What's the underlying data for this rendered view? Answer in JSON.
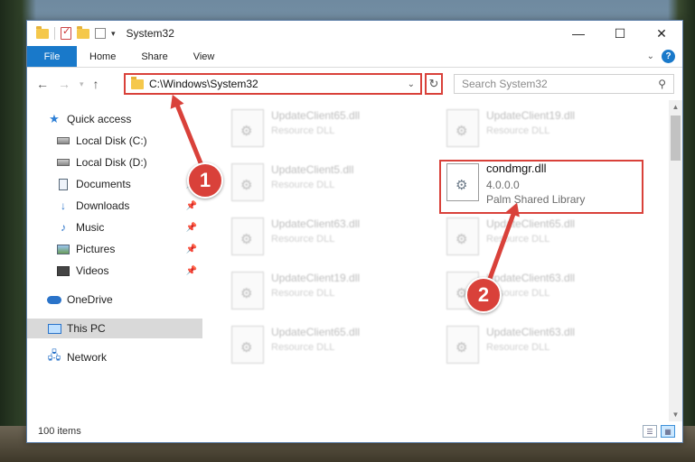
{
  "window": {
    "title": "System32",
    "controls": {
      "minimize": "—",
      "maximize": "☐",
      "close": "✕"
    }
  },
  "ribbon": {
    "tabs": [
      "File",
      "Home",
      "Share",
      "View"
    ],
    "help": "?"
  },
  "address": {
    "path": "C:\\Windows\\System32",
    "search_placeholder": "Search System32"
  },
  "sidebar": {
    "items": [
      {
        "label": "Quick access",
        "icon": "star-icon",
        "pinned": false
      },
      {
        "label": "Local Disk (C:)",
        "icon": "disk-icon",
        "pinned": false
      },
      {
        "label": "Local Disk (D:)",
        "icon": "disk-icon",
        "pinned": false
      },
      {
        "label": "Documents",
        "icon": "documents-icon",
        "pinned": true
      },
      {
        "label": "Downloads",
        "icon": "downloads-icon",
        "pinned": true
      },
      {
        "label": "Music",
        "icon": "music-icon",
        "pinned": true
      },
      {
        "label": "Pictures",
        "icon": "pictures-icon",
        "pinned": true
      },
      {
        "label": "Videos",
        "icon": "videos-icon",
        "pinned": true
      },
      {
        "label": "OneDrive",
        "icon": "onedrive-icon",
        "pinned": false
      },
      {
        "label": "This PC",
        "icon": "this-pc-icon",
        "pinned": false,
        "selected": true
      },
      {
        "label": "Network",
        "icon": "network-icon",
        "pinned": false
      }
    ]
  },
  "files": [
    {
      "name": "UpdateClient65.dll",
      "desc": "Resource DLL"
    },
    {
      "name": "UpdateClient19.dll",
      "desc": "Resource DLL"
    },
    {
      "name": "UpdateClient5.dll",
      "desc": "Resource DLL"
    },
    {
      "name": "condmgr.dll",
      "version": "4.0.0.0",
      "desc": "Palm Shared Library"
    },
    {
      "name": "UpdateClient63.dll",
      "desc": "Resource DLL"
    },
    {
      "name": "UpdateClient65.dll",
      "desc": "Resource DLL"
    },
    {
      "name": "UpdateClient19.dll",
      "desc": "Resource DLL"
    },
    {
      "name": "UpdateClient63.dll",
      "desc": "Resource DLL"
    },
    {
      "name": "UpdateClient65.dll",
      "desc": "Resource DLL"
    },
    {
      "name": "UpdateClient63.dll",
      "desc": "Resource DLL"
    }
  ],
  "status": {
    "item_count": "100 items"
  },
  "annotations": {
    "step1": "1",
    "step2": "2",
    "color": "#d9413a"
  }
}
